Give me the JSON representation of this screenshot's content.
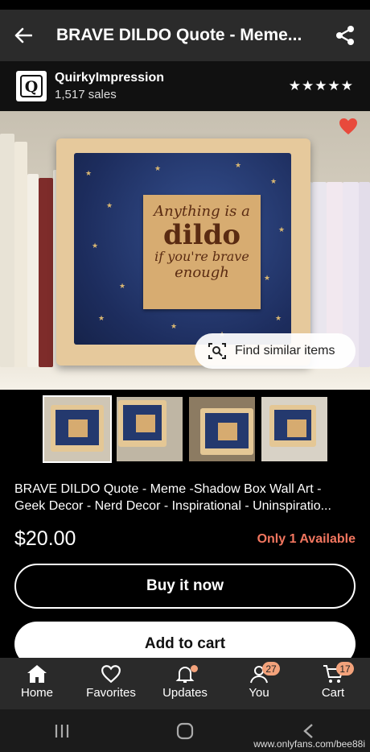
{
  "header": {
    "title": "BRAVE DILDO Quote - Meme..."
  },
  "shop": {
    "name": "QuirkyImpression",
    "sales": "1,517 sales",
    "rating_stars": "★★★★★",
    "logo_letter": "Q"
  },
  "hero": {
    "plaque_lines": [
      "Anything is a",
      "dildo",
      "if you're brave",
      "enough"
    ],
    "find_similar_label": "Find similar items"
  },
  "listing": {
    "title": "BRAVE DILDO Quote - Meme -Shadow Box Wall Art - Geek Decor - Nerd Decor - Inspirational - Uninspiratio...",
    "price": "$20.00",
    "availability": "Only 1 Available",
    "buy_now_label": "Buy it now",
    "add_to_cart_label": "Add to cart"
  },
  "tabs": [
    {
      "label": "Home",
      "icon": "home-icon"
    },
    {
      "label": "Favorites",
      "icon": "heart-icon"
    },
    {
      "label": "Updates",
      "icon": "bell-icon"
    },
    {
      "label": "You",
      "icon": "user-icon",
      "badge": "27"
    },
    {
      "label": "Cart",
      "icon": "cart-icon",
      "badge": "17"
    }
  ],
  "watermark": "www.onlyfans.com/bee88i",
  "colors": {
    "accent_badge": "#f3a27b",
    "availability": "#f2765f",
    "heart": "#e84a3c"
  }
}
